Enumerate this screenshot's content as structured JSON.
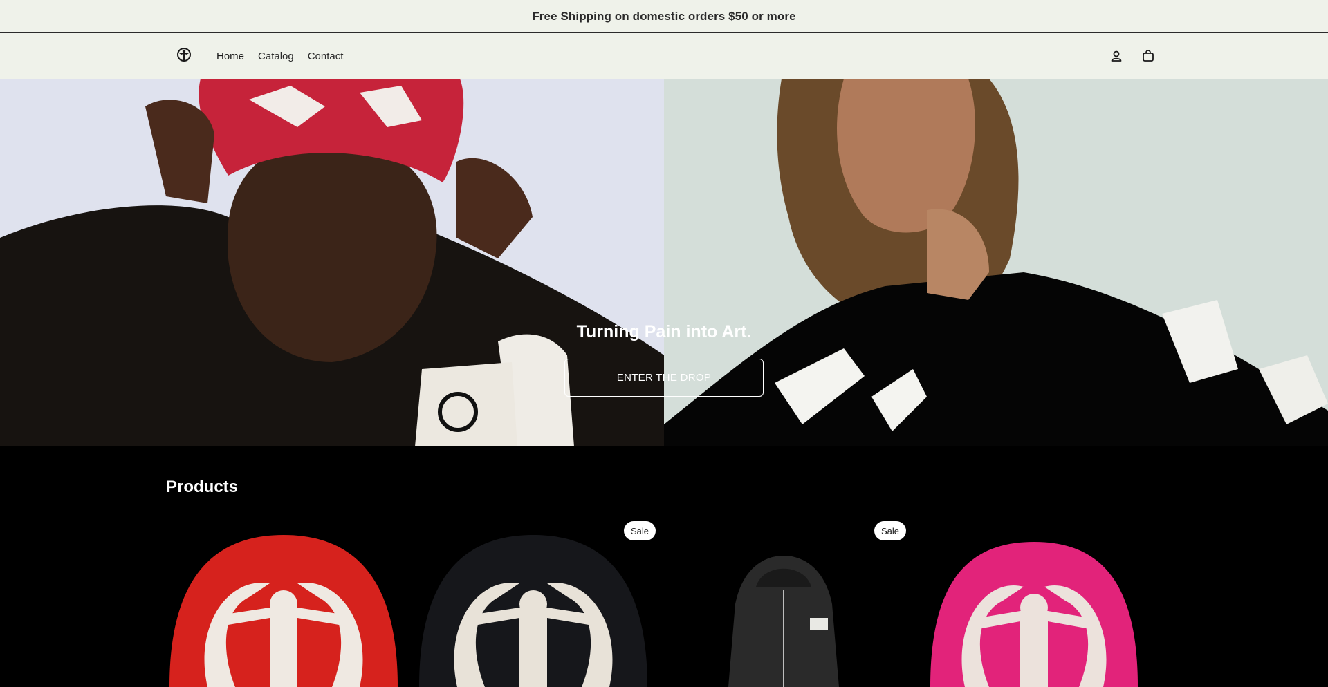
{
  "announcement": {
    "text": "Free Shipping on domestic orders $50 or more"
  },
  "header": {
    "logo_icon": "crest-logo-icon",
    "nav": [
      {
        "label": "Home"
      },
      {
        "label": "Catalog"
      },
      {
        "label": "Contact"
      }
    ],
    "account_icon": "user-icon",
    "cart_icon": "shopping-bag-icon"
  },
  "hero": {
    "title": "Turning Pain into Art.",
    "button_label": "ENTER THE DROP"
  },
  "products": {
    "title": "Products",
    "items": [
      {
        "image": "red beanie",
        "badge": ""
      },
      {
        "image": "black beanie",
        "badge": "Sale"
      },
      {
        "image": "black zip hoodie",
        "badge": "Sale"
      },
      {
        "image": "pink beanie",
        "badge": ""
      }
    ]
  },
  "colors": {
    "header_bg": "#eff2ea",
    "text_dark": "#2a2a2a",
    "page_bg": "#000000"
  }
}
